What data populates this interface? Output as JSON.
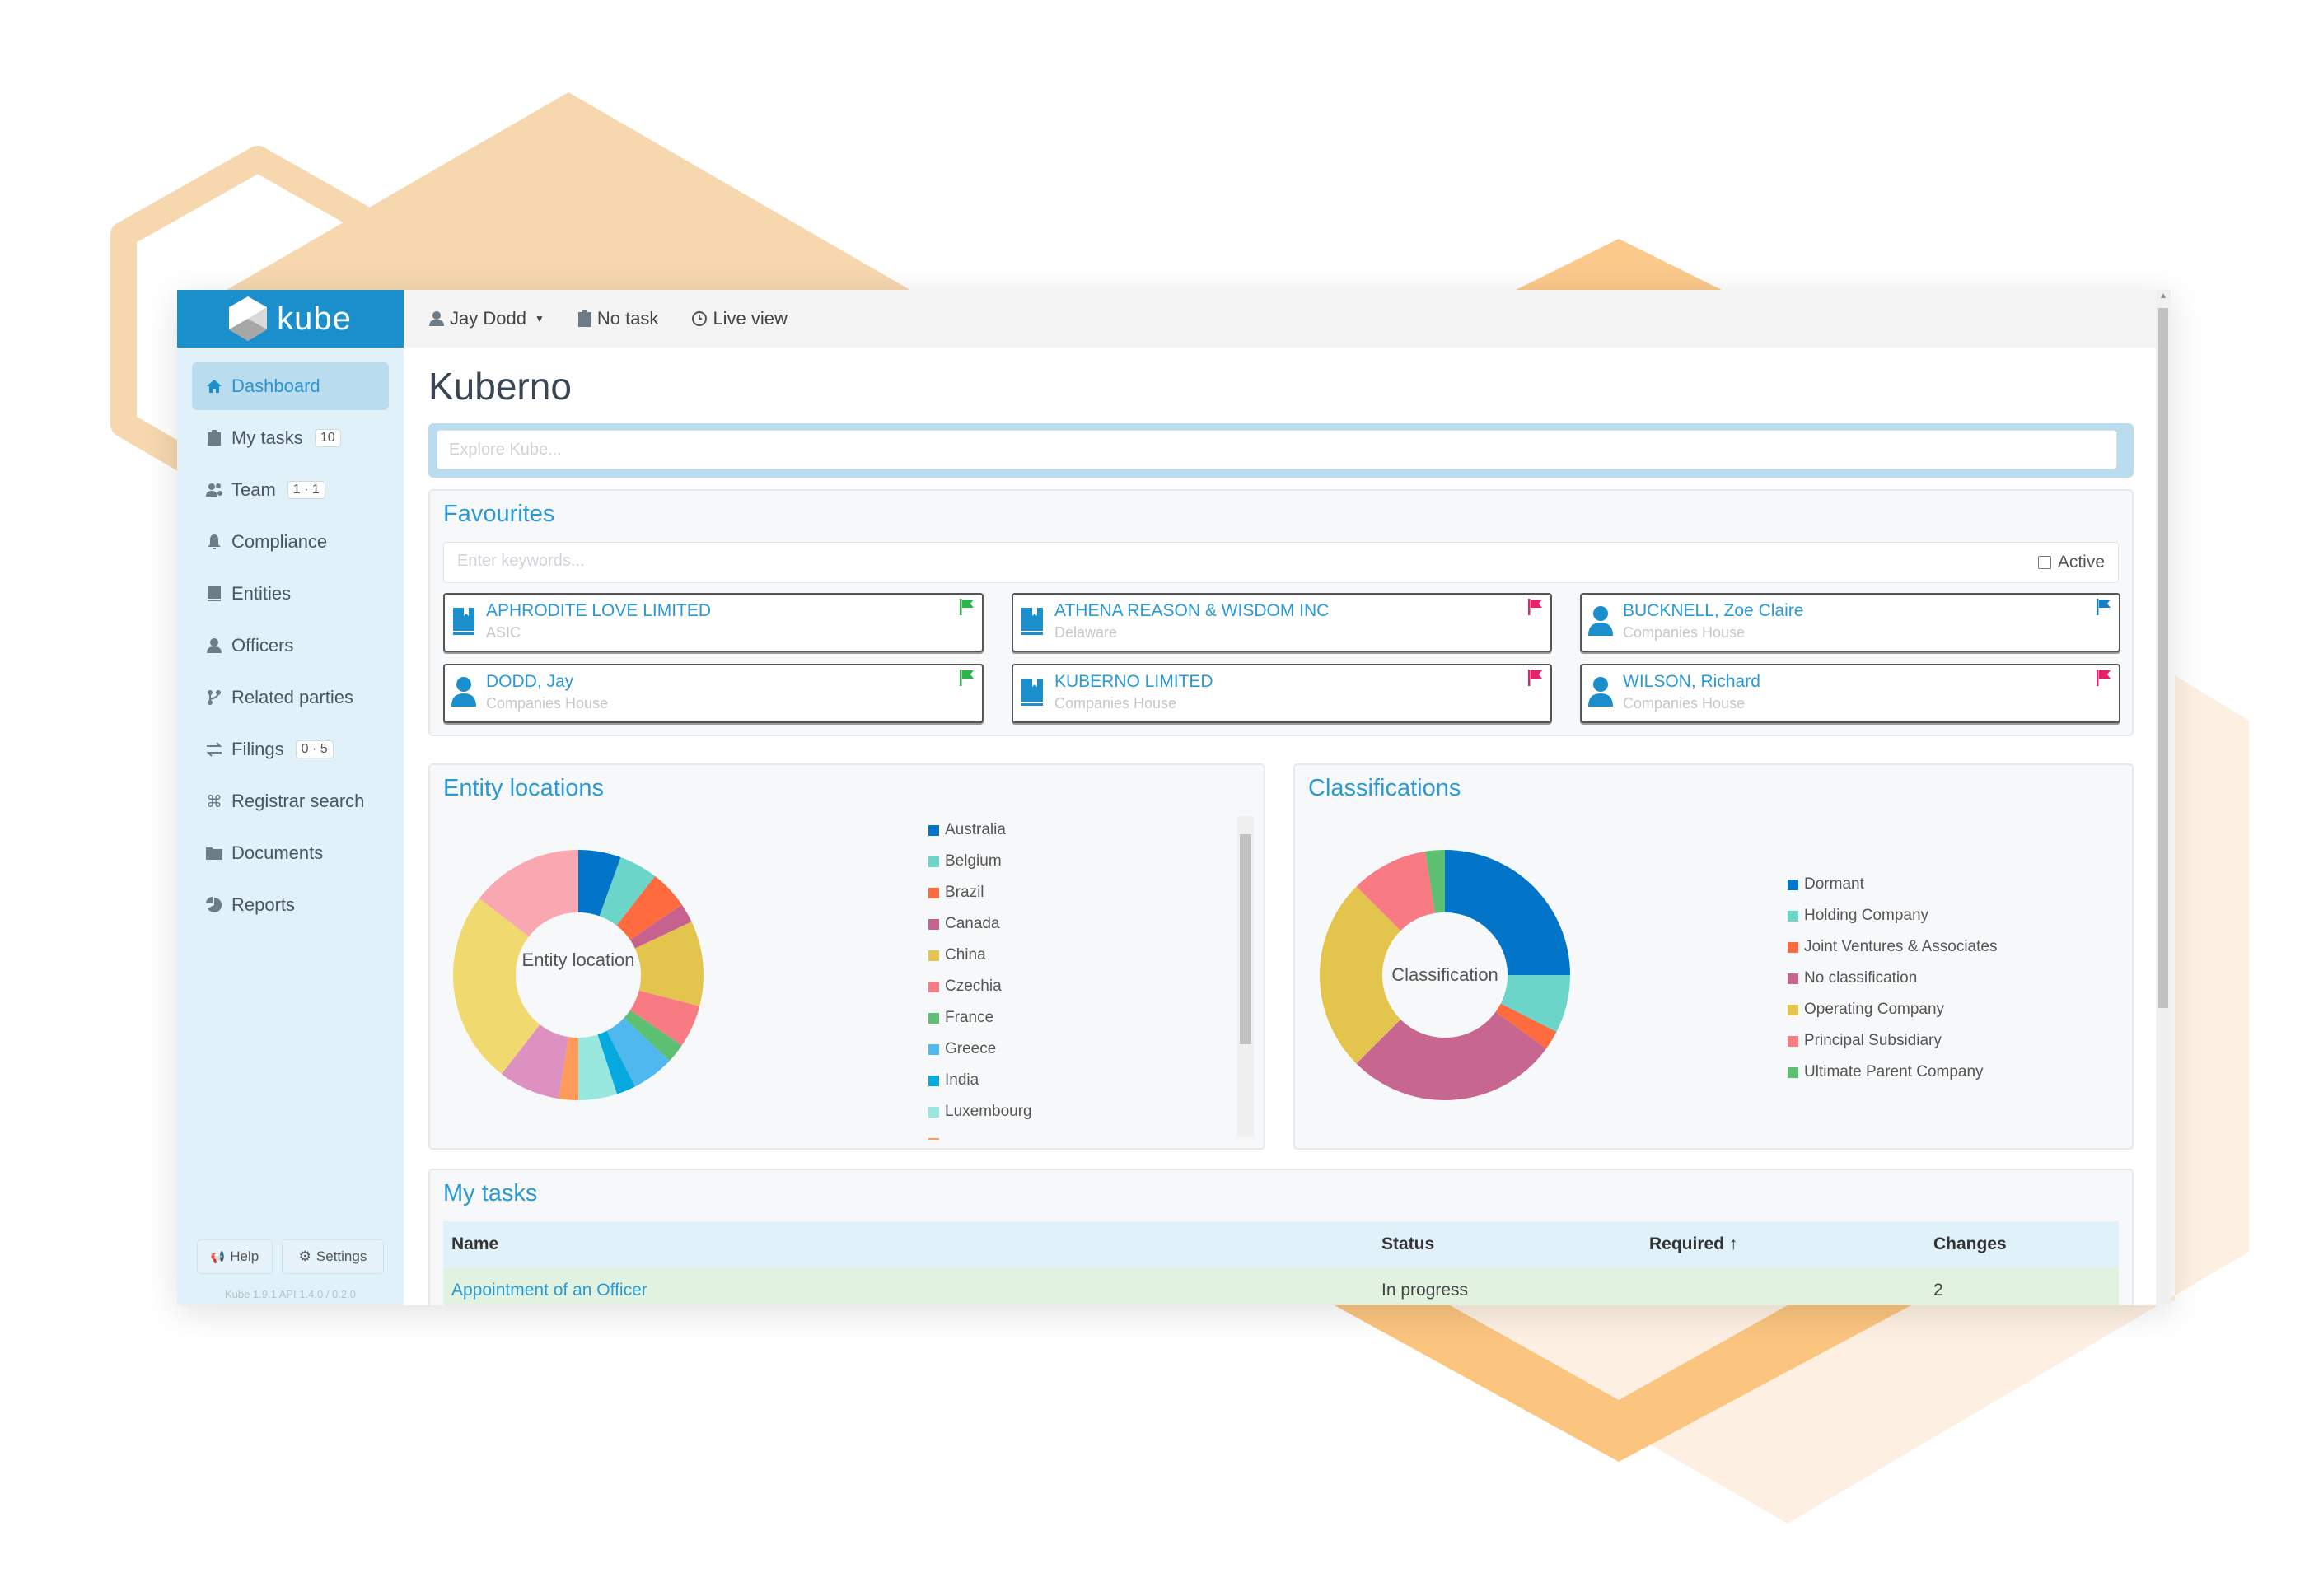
{
  "brand": {
    "name": "kube",
    "color": "#1b8fcc"
  },
  "topbar": {
    "user": "Jay Dodd",
    "task": "No task",
    "live_view": "Live view"
  },
  "sidebar": {
    "items": [
      {
        "label": "Dashboard",
        "icon": "home-icon",
        "active": true
      },
      {
        "label": "My tasks",
        "icon": "clipboard-icon",
        "badge": "10"
      },
      {
        "label": "Team",
        "icon": "users-icon",
        "badge": "1 · 1"
      },
      {
        "label": "Compliance",
        "icon": "bell-icon"
      },
      {
        "label": "Entities",
        "icon": "book-icon"
      },
      {
        "label": "Officers",
        "icon": "user-icon"
      },
      {
        "label": "Related parties",
        "icon": "branch-icon"
      },
      {
        "label": "Filings",
        "icon": "exchange-icon",
        "badge": "0 · 5"
      },
      {
        "label": "Registrar search",
        "icon": "command-icon"
      },
      {
        "label": "Documents",
        "icon": "folder-icon"
      },
      {
        "label": "Reports",
        "icon": "pie-icon"
      }
    ],
    "help_label": "Help",
    "settings_label": "Settings",
    "version": "Kube 1.9.1 API 1.4.0 / 0.2.0"
  },
  "main": {
    "title": "Kuberno",
    "explore_placeholder": "Explore Kube...",
    "favourites": {
      "title": "Favourites",
      "filter_placeholder": "Enter keywords...",
      "active_label": "Active",
      "active_checked": false,
      "cards": [
        {
          "name": "APHRODITE LOVE LIMITED",
          "sub": "ASIC",
          "type": "entity",
          "flag_color": "#2fb34a"
        },
        {
          "name": "ATHENA REASON & WISDOM INC",
          "sub": "Delaware",
          "type": "entity",
          "flag_color": "#e8226a"
        },
        {
          "name": "BUCKNELL, Zoe Claire",
          "sub": "Companies House",
          "type": "officer",
          "flag_color": "#1b7fc4"
        },
        {
          "name": "DODD, Jay",
          "sub": "Companies House",
          "type": "officer",
          "flag_color": "#2fb34a"
        },
        {
          "name": "KUBERNO LIMITED",
          "sub": "Companies House",
          "type": "entity",
          "flag_color": "#e8226a"
        },
        {
          "name": "WILSON, Richard",
          "sub": "Companies House",
          "type": "officer",
          "flag_color": "#e8226a"
        }
      ]
    },
    "my_tasks": {
      "title": "My tasks",
      "columns": [
        "Name",
        "Status",
        "Required",
        "Changes"
      ],
      "sort_column": "Required",
      "rows": [
        {
          "name": "Appointment of an Officer",
          "status": "In progress",
          "required": "",
          "changes": "2"
        }
      ]
    }
  },
  "chart_data": [
    {
      "type": "pie",
      "variant": "donut",
      "title": "Entity locations",
      "center_label": "Entity location",
      "legend_position": "right",
      "legend_scrollable": true,
      "categories": [
        "Australia",
        "Belgium",
        "Brazil",
        "Canada",
        "China",
        "Czechia",
        "France",
        "Greece",
        "India",
        "Luxembourg",
        "",
        "",
        "",
        ""
      ],
      "values": [
        5.5,
        5,
        5,
        2.5,
        11,
        5.5,
        2.5,
        5.5,
        2.5,
        5,
        2.5,
        8,
        25,
        14.5
      ],
      "colors": [
        "#0275c9",
        "#6ad5c8",
        "#fd6b3e",
        "#c7628f",
        "#e3c44c",
        "#f87a82",
        "#5cbf72",
        "#4fb9ef",
        "#05a8df",
        "#98e8e0",
        "#fe9a5a",
        "#dd91c0",
        "#f0da70",
        "#f9a7b0"
      ],
      "legend_visible_count": 10
    },
    {
      "type": "pie",
      "variant": "donut",
      "title": "Classifications",
      "center_label": "Classification",
      "legend_position": "right",
      "categories": [
        "Dormant",
        "Holding Company",
        "Joint Ventures & Associates",
        "No classification",
        "Operating Company",
        "Principal Subsidiary",
        "Ultimate Parent Company"
      ],
      "values": [
        25,
        7.5,
        2.5,
        27.5,
        25,
        10,
        2.5
      ],
      "colors": [
        "#0275c9",
        "#6ad5c8",
        "#fd6b3e",
        "#c7668f",
        "#e3c44c",
        "#f87a82",
        "#5cbf72"
      ]
    }
  ]
}
